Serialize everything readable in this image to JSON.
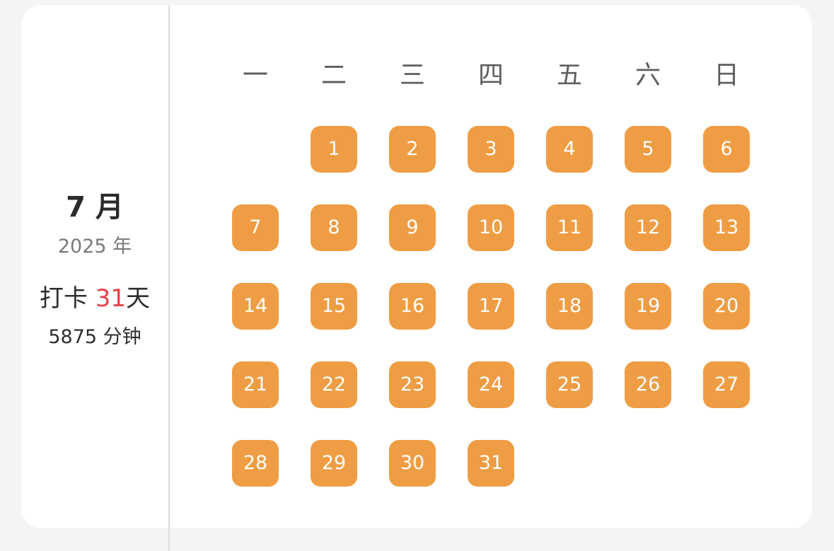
{
  "summary": {
    "month": "7 月",
    "year": "2025 年",
    "checkin_prefix": "打卡 ",
    "checkin_days": "31",
    "checkin_suffix": "天",
    "minutes": "5875 分钟"
  },
  "calendar": {
    "weekdays": [
      "一",
      "二",
      "三",
      "四",
      "五",
      "六",
      "日"
    ],
    "first_weekday_index": 1,
    "days": [
      "1",
      "2",
      "3",
      "4",
      "5",
      "6",
      "7",
      "8",
      "9",
      "10",
      "11",
      "12",
      "13",
      "14",
      "15",
      "16",
      "17",
      "18",
      "19",
      "20",
      "21",
      "22",
      "23",
      "24",
      "25",
      "26",
      "27",
      "28",
      "29",
      "30",
      "31"
    ],
    "day_color": "#ef9d44"
  }
}
